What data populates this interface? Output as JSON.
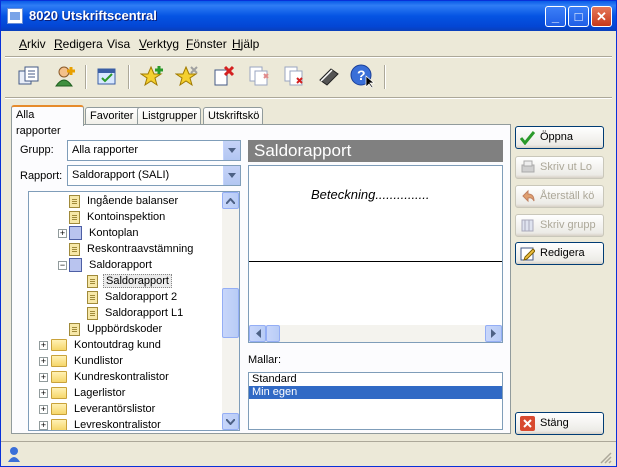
{
  "window": {
    "title": "8020 Utskriftscentral",
    "controls": {
      "minimize": "_",
      "maximize": "□",
      "close": "✕"
    }
  },
  "menu": [
    {
      "text": "Arkiv",
      "key": "A"
    },
    {
      "text": "Redigera",
      "key": "R"
    },
    {
      "text": "Visa",
      "key": ""
    },
    {
      "text": "Verktyg",
      "key": "V"
    },
    {
      "text": "Fönster",
      "key": "F"
    },
    {
      "text": "Hjälp",
      "key": "H"
    }
  ],
  "tabs": [
    "Alla rapporter",
    "Favoriter",
    "Listgrupper",
    "Utskriftskö"
  ],
  "filters": {
    "group_label": "Grupp:",
    "group_value": "Alla rapporter",
    "report_label": "Rapport:",
    "report_value": "Saldorapport (SALI)"
  },
  "tree": [
    {
      "label": "Ingående balanser",
      "icon": "doc"
    },
    {
      "label": "Kontoinspektion",
      "icon": "doc"
    },
    {
      "label": "Kontoplan",
      "icon": "book",
      "expander": "+"
    },
    {
      "label": "Reskontraavstämning",
      "icon": "doc"
    },
    {
      "label": "Saldorapport",
      "icon": "book",
      "expander": "−"
    },
    {
      "label": "Saldorapport",
      "icon": "doc",
      "selected": true
    },
    {
      "label": "Saldorapport 2",
      "icon": "doc"
    },
    {
      "label": "Saldorapport L1",
      "icon": "doc"
    },
    {
      "label": "Uppbördskoder",
      "icon": "doc"
    },
    {
      "label": "Kontoutdrag kund",
      "icon": "folder",
      "expander": "+"
    },
    {
      "label": "Kundlistor",
      "icon": "folder",
      "expander": "+"
    },
    {
      "label": "Kundreskontralistor",
      "icon": "folder",
      "expander": "+"
    },
    {
      "label": "Lagerlistor",
      "icon": "folder",
      "expander": "+"
    },
    {
      "label": "Leverantörslistor",
      "icon": "folder",
      "expander": "+"
    },
    {
      "label": "Levreskontralistor",
      "icon": "folder",
      "expander": "+"
    }
  ],
  "preview": {
    "title": "Saldorapport",
    "sample_text": "Beteckning..............."
  },
  "templates": {
    "label": "Mallar:",
    "items": [
      {
        "label": "Standard",
        "selected": false
      },
      {
        "label": "Min egen",
        "selected": true
      }
    ]
  },
  "buttons": {
    "open": "Öppna",
    "print": "Skriv ut Lo",
    "restore": "Återställ kö",
    "print_group": "Skriv grupp",
    "edit": "Redigera",
    "close": "Stäng"
  },
  "colors": {
    "titlebar": "#0554e3",
    "selection": "#316ac5",
    "tab_accent": "#e68b2c",
    "preview_header": "#808080"
  },
  "toolbar_icons": [
    "report-properties-icon",
    "add-user-icon",
    "schedule-icon",
    "add-favorite-icon",
    "favorite-icon",
    "delete-icon",
    "copy-icon",
    "remove-icon",
    "dictionary-icon",
    "help-icon"
  ]
}
